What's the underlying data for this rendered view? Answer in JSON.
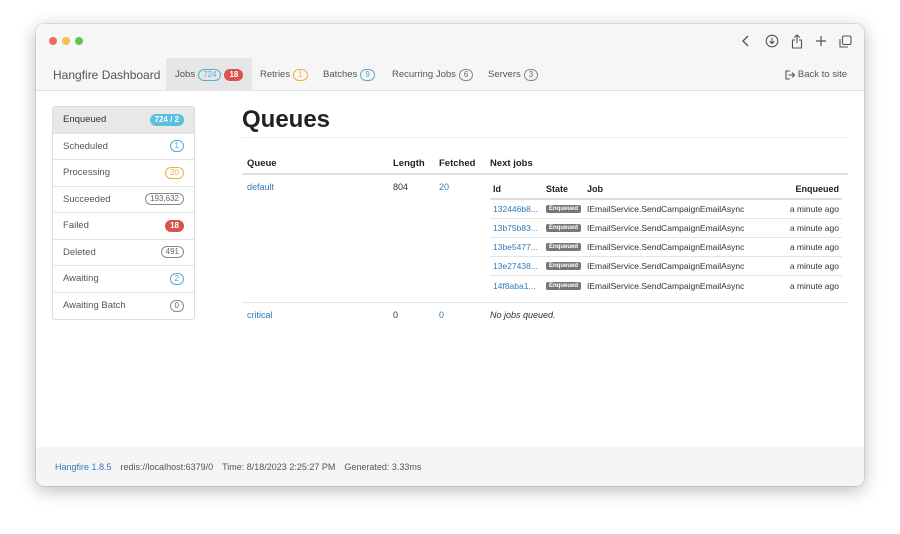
{
  "navbar": {
    "brand": "Hangfire Dashboard",
    "items": [
      {
        "label": "Jobs",
        "count": "724",
        "count2": "18"
      },
      {
        "label": "Retries",
        "count": "1"
      },
      {
        "label": "Batches",
        "count": "9"
      },
      {
        "label": "Recurring Jobs",
        "count": "6"
      },
      {
        "label": "Servers",
        "count": "3"
      }
    ],
    "back": "Back to site"
  },
  "sidebar": {
    "items": [
      {
        "label": "Enqueued",
        "count": "724 / 2"
      },
      {
        "label": "Scheduled",
        "count": "1"
      },
      {
        "label": "Processing",
        "count": "20"
      },
      {
        "label": "Succeeded",
        "count": "193,632"
      },
      {
        "label": "Failed",
        "count": "18"
      },
      {
        "label": "Deleted",
        "count": "491"
      },
      {
        "label": "Awaiting",
        "count": "2"
      },
      {
        "label": "Awaiting Batch",
        "count": "0"
      }
    ]
  },
  "main": {
    "title": "Queues",
    "columns": [
      "Queue",
      "Length",
      "Fetched",
      "Next jobs"
    ],
    "job_columns": [
      "Id",
      "State",
      "Job",
      "Enqueued"
    ],
    "queues": [
      {
        "name": "default",
        "length": "804",
        "fetched": "20",
        "jobs": [
          {
            "id": "132446b8...",
            "state": "Enqueued",
            "job": "IEmailService.SendCampaignEmailAsync",
            "enqueued": "a minute ago"
          },
          {
            "id": "13b75b83...",
            "state": "Enqueued",
            "job": "IEmailService.SendCampaignEmailAsync",
            "enqueued": "a minute ago"
          },
          {
            "id": "13be5477...",
            "state": "Enqueued",
            "job": "IEmailService.SendCampaignEmailAsync",
            "enqueued": "a minute ago"
          },
          {
            "id": "13e27438...",
            "state": "Enqueued",
            "job": "IEmailService.SendCampaignEmailAsync",
            "enqueued": "a minute ago"
          },
          {
            "id": "14f8aba1...",
            "state": "Enqueued",
            "job": "IEmailService.SendCampaignEmailAsync",
            "enqueued": "a minute ago"
          }
        ]
      },
      {
        "name": "critical",
        "length": "0",
        "fetched": "0",
        "empty": "No jobs queued."
      }
    ]
  },
  "footer": {
    "version": "Hangfire 1.8.5",
    "storage": "redis://localhost:6379/0",
    "time": "Time: 8/18/2023 2:25:27 PM",
    "generated": "Generated: 3.33ms"
  },
  "icons": {
    "back": "chevron-left-icon",
    "download": "download-icon",
    "share": "share-icon",
    "new_tab": "plus-icon",
    "tabs": "tabs-icon",
    "exit": "sign-out-icon"
  },
  "colors": {
    "link": "#337ab7",
    "badge_blue": "#5aa9d6",
    "badge_orange": "#f0ad4e",
    "badge_red": "#d9534f",
    "label_gray": "#777777"
  }
}
